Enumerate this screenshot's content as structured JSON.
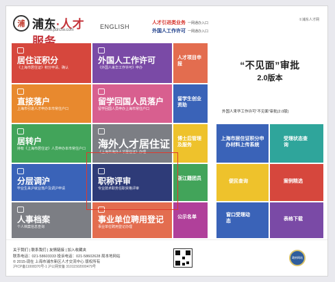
{
  "header": {
    "logo_emblem": "浦",
    "logo_name_a": "浦东",
    "logo_name_b": "·人才服务",
    "logo_url": "www.pdrcfw.com",
    "lang": "ENGLISH",
    "promo_line1": "人才引进类业务",
    "promo_line1_small": "一网通办入口",
    "promo_line2": "外国人工作许可",
    "promo_line2_small": "一网通办入口",
    "qr_title": "①浦东人才网"
  },
  "tiles": {
    "residence_points": {
      "title": "居住证积分",
      "sub": "《上海市居住证》积分申请、确认"
    },
    "foreign_work_permit": {
      "title": "外国人工作许可",
      "sub": "《外国人来华工作许可》申办"
    },
    "talent_project": {
      "title": "人才项目申报"
    },
    "direct_hukou": {
      "title": "直接落户",
      "sub": "上海市引进人才申办本市常住户口"
    },
    "overseas_hukou": {
      "title": "留学回国人员落户",
      "sub": "留学回国人员申办上海市常住户口"
    },
    "overseas_startup": {
      "title": "留学生创业资助"
    },
    "residence_to_hukou": {
      "title": "居转户",
      "sub": "持有《上海市居住证》人员申办本市常住户口"
    },
    "overseas_residence": {
      "title": "海外人才居住证",
      "sub": "《上海市海外人才居住证》办理"
    },
    "postdoc": {
      "title": "博士后管理及服务"
    },
    "grad_settlement": {
      "title": "分层调沪",
      "sub": "毕业生来沪就业落户及调沪申请"
    },
    "title_evaluation": {
      "title": "职称评审",
      "sub": "专业技术职务任职资格评审"
    },
    "zhejiang": {
      "title": "浙江籍团员"
    },
    "personnel_archive": {
      "title": "人事档案",
      "sub": "个人档案信息查询"
    },
    "institution_hiring": {
      "title": "事业单位聘用登记",
      "sub": "事业单位聘用登记办理"
    },
    "public_list": {
      "title": "公示名单"
    },
    "residence_material_upload": {
      "title": "上海市居住证积分申办材料上传系统"
    },
    "status_query": {
      "title": "受理状态查询"
    },
    "convenient_query": {
      "title": "便民查询"
    },
    "case_select": {
      "title": "案例精选"
    },
    "window_dynamics": {
      "title": "窗口受理动态"
    },
    "form_download": {
      "title": "表格下载"
    }
  },
  "banner": {
    "line1": "“不见面”审批",
    "line2": "2.0版本",
    "caption": "外国人来华工作许可“不见面”审批(2.0版)"
  },
  "footer": {
    "links": "关于我们 | 联系我们 | 友情链接 | 加入收藏夹",
    "contact": "联系电话：021-58603333   投诉电话：021-58602628   局本地网站",
    "copyright": "© 2015-现在 上海市浦东新区人才交流中心 版权所有",
    "icp": "沪ICP备11008370号-1   沪公网安备 31011502000479号",
    "badge": "政府网站"
  },
  "colors": {
    "red": "#d6473d",
    "purple": "#7a4aa6",
    "orange": "#e8892e",
    "green": "#42a45a",
    "gray": "#7c7e84",
    "yellow": "#eec22c",
    "blue": "#3a63b8",
    "navy": "#2e3b78",
    "magenta": "#b0409a",
    "teal": "#2fa59b",
    "pink": "#d85f8f",
    "salmon": "#e36d4f"
  }
}
